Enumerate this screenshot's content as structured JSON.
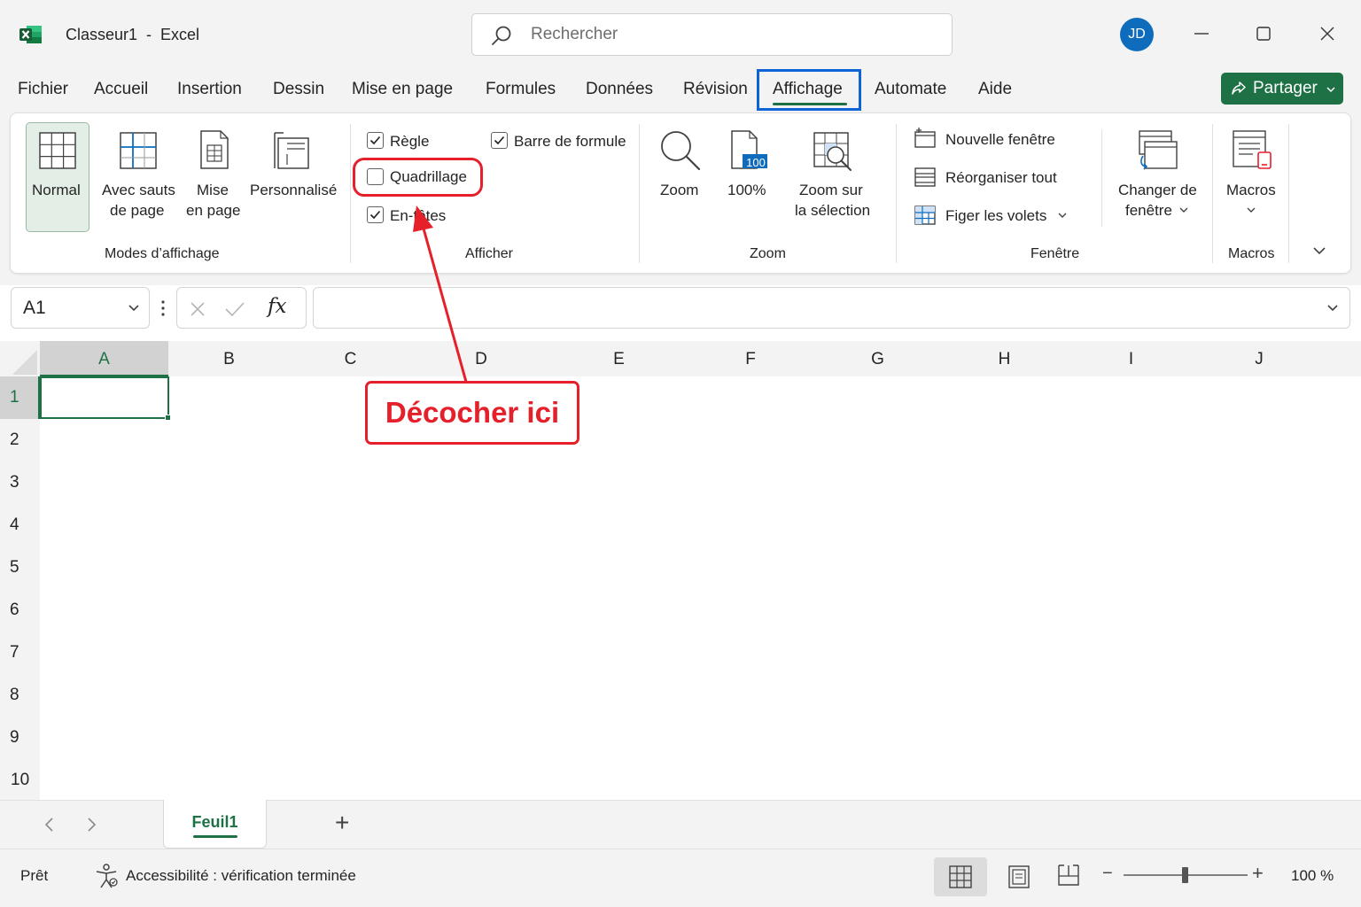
{
  "window": {
    "title": "Classeur1  -  Excel",
    "search_placeholder": "Rechercher",
    "avatar_initials": "JD"
  },
  "menu": {
    "tabs": [
      "Fichier",
      "Accueil",
      "Insertion",
      "Dessin",
      "Mise en page",
      "Formules",
      "Données",
      "Révision",
      "Affichage",
      "Automate",
      "Aide"
    ],
    "active_tab": "Affichage",
    "share_label": "Partager"
  },
  "ribbon": {
    "modes": {
      "group_label": "Modes d’affichage",
      "normal": "Normal",
      "page_break_1": "Avec sauts",
      "page_break_2": "de page",
      "page_layout_1": "Mise",
      "page_layout_2": "en page",
      "custom": "Personnalisé"
    },
    "show": {
      "group_label": "Afficher",
      "ruler": "Règle",
      "formula_bar": "Barre de formule",
      "gridlines": "Quadrillage",
      "headings": "En-têtes",
      "checked": {
        "ruler": true,
        "formula_bar": true,
        "gridlines": false,
        "headings": true
      }
    },
    "zoom": {
      "group_label": "Zoom",
      "zoom": "Zoom",
      "hundred": "100%",
      "hundred_badge": "100",
      "selection_1": "Zoom sur",
      "selection_2": "la sélection"
    },
    "window": {
      "group_label": "Fenêtre",
      "new_window": "Nouvelle fenêtre",
      "arrange_all": "Réorganiser tout",
      "freeze_panes": "Figer les volets",
      "switch_1": "Changer de",
      "switch_2": "fenêtre"
    },
    "macros": {
      "group_label": "Macros",
      "macros": "Macros"
    }
  },
  "formula_bar": {
    "name_box": "A1",
    "fx": "fx",
    "value": ""
  },
  "grid": {
    "columns": [
      "A",
      "B",
      "C",
      "D",
      "E",
      "F",
      "G",
      "H",
      "I",
      "J"
    ],
    "rows": [
      "1",
      "2",
      "3",
      "4",
      "5",
      "6",
      "7",
      "8",
      "9",
      "10"
    ],
    "selected_cell": "A1"
  },
  "annotation": {
    "callout": "Décocher ici",
    "color": "#e5202a"
  },
  "sheets": {
    "tabs": [
      "Feuil1"
    ],
    "add": "+"
  },
  "status": {
    "ready": "Prêt",
    "accessibility": "Accessibilité : vérification terminée",
    "zoom": "100 %"
  },
  "colors": {
    "excel_green": "#1e7145",
    "highlight_blue": "#0e63d6",
    "avatar_blue": "#0f6cbd"
  }
}
